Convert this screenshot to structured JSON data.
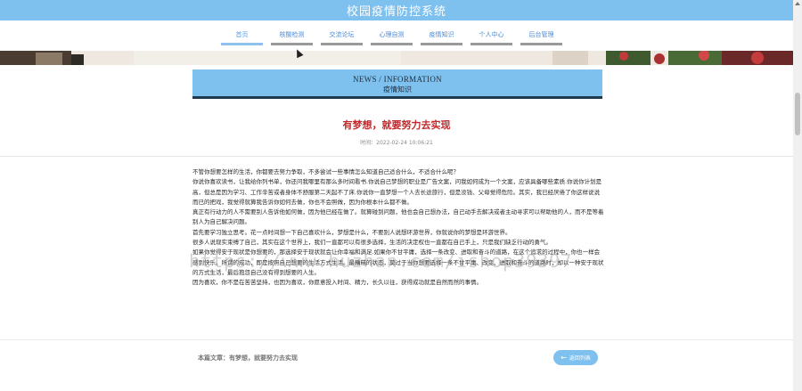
{
  "header": {
    "title": "校园疫情防控系统"
  },
  "nav": {
    "items": [
      {
        "label": "首页"
      },
      {
        "label": "核酸检测"
      },
      {
        "label": "交流论坛"
      },
      {
        "label": "心理自测"
      },
      {
        "label": "疫情知识"
      },
      {
        "label": "个人中心"
      },
      {
        "label": "后台管理"
      }
    ],
    "active_index": 0
  },
  "news_header": {
    "en": "NEWS / INFORMATION",
    "cn": "疫情知识"
  },
  "article": {
    "title": "有梦想，就要努力去实现",
    "time": "时间：2022-02-24 10:06:21",
    "paragraphs": [
      "不管你想要怎样的生活，你都要去努力争取，不多尝试一些事情怎么知道自己适合什么，不适合什么呢？",
      "你说你喜欢读书，让我给你列书单，你还问我哪里有那么多时间看书.你说自己梦想的职业是广告文案，问我如何成为一个文案，应该具备哪些素质.你说你计划是高，但总是因为学习、工作辛苦或者身体不舒服第二天起不了床.你说你一直梦想一个人去长途旅行，但是没钱、父母觉得危险。其实，我已经厌倦了你这样说说而已的把戏，我觉得就算我告诉你如何去做，你也不会照做，因为你根本什么都不做。",
      "真正有行动力的人不需要别人告诉他如何做，因为他已经在做了。就算碰到问题，他也会自己想办法，自己动手去解决或者主动寻求可以帮助他的人，而不是等着别人为自己解决问题。",
      "首先要学习独立思考。花一点时间想一下自己喜欢什么，梦想是什么，不要别人说想环游世界，你就说你的梦想是环游世界。",
      "很多人说现实束缚了自己，其实在这个世界上，我们一直都可以有很多选择，生活的决定权也一直都在自己手上，只是我们缺乏行动的勇气。",
      "如果你觉得安于现状是你想要的，那选择安于现状就会让你幸福和满足.如果你不甘平庸，选择一条改变、进取和奋斗的道路，在这个追求的过程中，你也一样会感到快乐。所谓的成功，即是按照自己想要的生活方式生活。最糟糕的状态，莫过于当你想要选择一条不甘平庸、改变、进取和奋斗的道路时，却以一种安于现状的方式生活，最后抱怨自己没有得到想要的人生。",
      "因为喜欢，你不是在苦苦坚持，也因为喜欢，你愿意投入时间、精力，长久以往，获得成功就是自然而然的事情。"
    ]
  },
  "watermark": "https://www.huzhan.com/ishop39397",
  "footer": {
    "this_article": "本篇文章：有梦想，就要努力去实现",
    "back_label": "返回列表",
    "back_icon": "arrow-left-icon"
  },
  "colors": {
    "primary": "#7ec0ee",
    "title_red": "#c0282b",
    "nav_link": "#4a8ad8"
  }
}
